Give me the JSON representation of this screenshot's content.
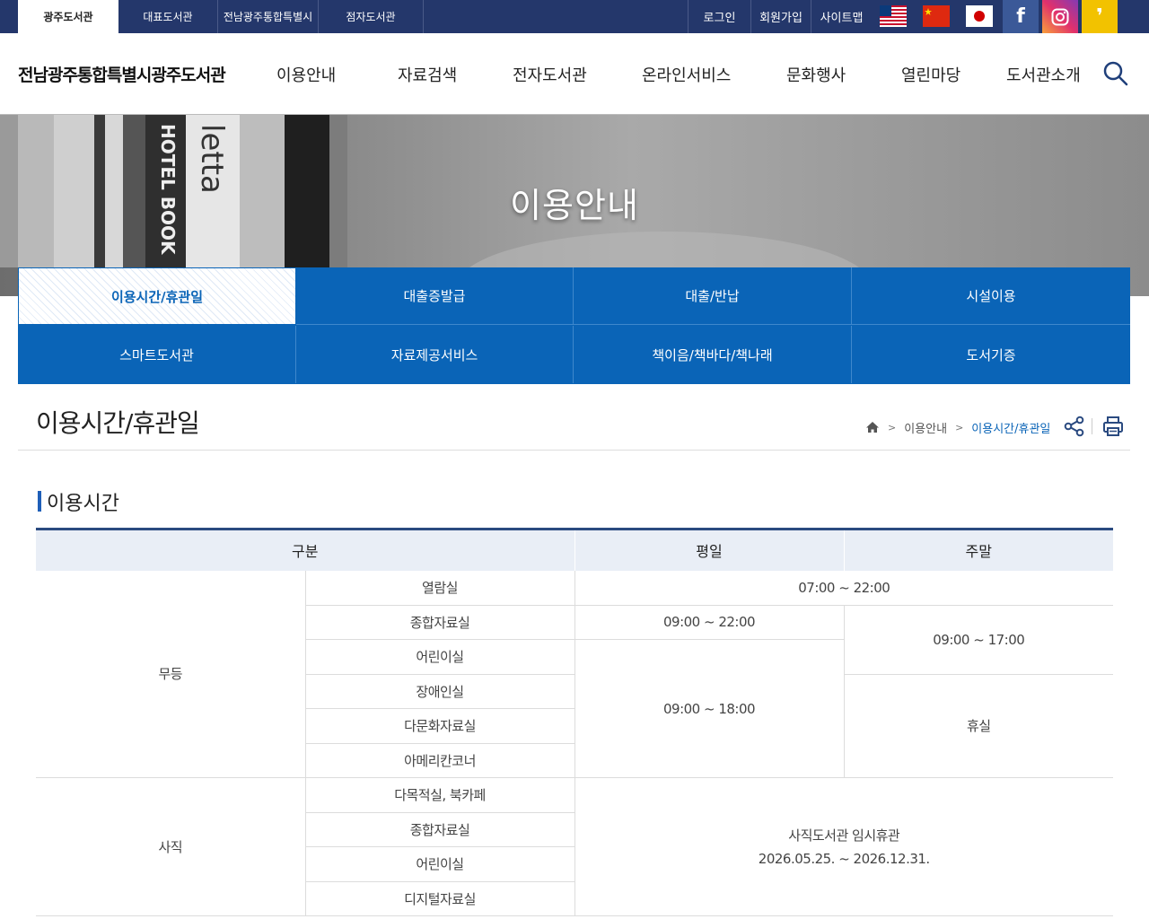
{
  "topbar": {
    "library_tabs": [
      "광주도서관",
      "대표도서관",
      "전남광주통합특별시",
      "점자도서관"
    ],
    "utility_links": [
      "로그인",
      "회원가입",
      "사이트맵"
    ],
    "social": {
      "facebook_label": "f",
      "kakao_label": "❜"
    }
  },
  "header": {
    "logo": "전남광주통합특별시광주도서관",
    "menu": [
      "이용안내",
      "자료검색",
      "전자도서관",
      "온라인서비스",
      "문화행사",
      "열린마당",
      "도서관소개"
    ]
  },
  "banner": {
    "title": "이용안내"
  },
  "subnav": {
    "items": [
      "이용시간/휴관일",
      "대출증발급",
      "대출/반납",
      "시설이용",
      "스마트도서관",
      "자료제공서비스",
      "책이음/책바다/책나래",
      "도서기증"
    ],
    "active_index": 0
  },
  "page": {
    "title": "이용시간/휴관일",
    "breadcrumb": [
      "이용안내",
      "이용시간/휴관일"
    ]
  },
  "section": {
    "title": "이용시간"
  },
  "hours_table": {
    "headers": [
      "구분",
      "평일",
      "주말"
    ],
    "mudeung": {
      "branch": "무등",
      "rooms": [
        "열람실",
        "종합자료실",
        "어린이실",
        "장애인실",
        "다문화자료실",
        "아메리칸코너"
      ],
      "reading_room_hours": "07:00 ~ 22:00",
      "general_weekday": "09:00 ~ 22:00",
      "weekend_hours": "09:00 ~ 17:00",
      "others_weekday": "09:00 ~ 18:00",
      "others_weekend": "휴실"
    },
    "sajik": {
      "branch": "사직",
      "rooms": [
        "다목적실, 북카페",
        "종합자료실",
        "어린이실",
        "디지털자료실"
      ],
      "notice_line1": "사직도서관 임시휴관",
      "notice_line2": "2026.05.25. ~ 2026.12.31."
    }
  },
  "colors": {
    "navy": "#24376b",
    "blue": "#0a64b7",
    "header_bg": "#e9eef6",
    "accent_bar": "#1f5fb8"
  }
}
